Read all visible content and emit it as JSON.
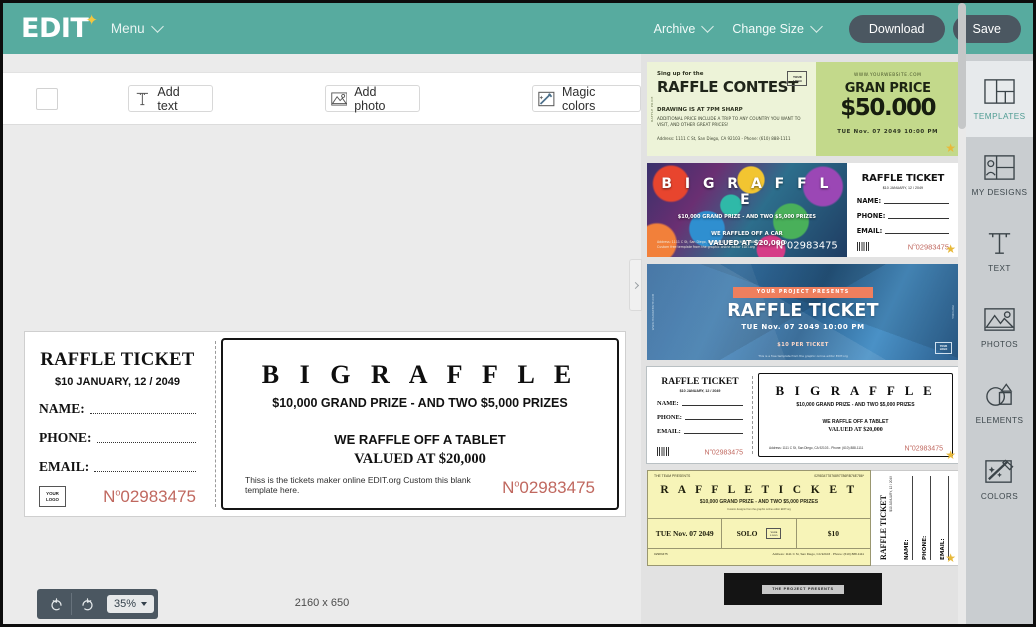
{
  "header": {
    "logo": "EDIT",
    "logo_star_icon": "star-icon",
    "menu_label": "Menu",
    "menu_chevron_icon": "chevron-down-icon",
    "archive_label": "Archive",
    "archive_chevron_icon": "chevron-down-icon",
    "change_size_label": "Change Size",
    "change_size_chevron_icon": "chevron-down-icon",
    "download_label": "Download",
    "save_label": "Save",
    "bg_color": "#57ab9f",
    "button_color": "#4b5761"
  },
  "toolbar": {
    "checkbox_name": "selection-checkbox",
    "add_text_label": "Add text",
    "add_text_icon": "text-tool-icon",
    "add_photo_label": "Add photo",
    "add_photo_icon": "image-icon",
    "magic_colors_label": "Magic colors",
    "magic_colors_icon": "magic-wand-icon"
  },
  "canvas": {
    "size_label": "2160 x 650",
    "zoom_level": "35%",
    "undo_icon": "undo-icon",
    "redo_icon": "redo-icon",
    "zoom_caret_icon": "caret-down-icon",
    "collapse_icon": "chevron-right-icon",
    "ticket": {
      "stub": {
        "title": "RAFFLE TICKET",
        "subtitle": "$10 JANUARY, 12 / 2049",
        "fields": [
          "NAME:",
          "PHONE:",
          "EMAIL:"
        ],
        "logo_line1": "YOUR",
        "logo_line2": "LOGO",
        "number_prefix": "N",
        "number_sup": "o",
        "number": "02983475",
        "number_color": "#c0685f"
      },
      "main": {
        "title": "B I G   R A F F L E",
        "subtitle": "$10,000 GRAND PRIZE - AND TWO $5,000 PRIZES",
        "line1": "WE RAFFLE OFF A TABLET",
        "line2": "VALUED AT $20,000",
        "note": "Thiss is the tickets maker online EDIT.org Custom this blank template here.",
        "number_prefix": "N",
        "number_sup": "o",
        "number": "02983475"
      }
    }
  },
  "templates": [
    {
      "id": "raffle-contest-green",
      "selected": false,
      "left": {
        "kicker": "Sing up for the",
        "title": "RAFFLE CONTEST",
        "subtitle": "DRAWING IS AT 7PM SHARP",
        "body": "ADDITIONAL PRICE INCLUDE A TRIP TO ANY COUNTRY YOU WANT TO VISIT, AND OTHER GREAT PRICES!",
        "address": "Address: 1111 C St, San Diego, CA 92103 - Phone: (610) 888-1111",
        "logo_line1": "YOUR",
        "logo_line2": "LOGO",
        "side_text": "RAFFLE PRICE"
      },
      "right": {
        "website": "WWW.YOURWEBSITE.COM",
        "title": "GRAN PRICE",
        "amount": "$50.000",
        "datetime": "TUE   Nov. 07   2049   10:00 PM",
        "side_text": "EDIT.ORG TEMPLATE"
      }
    },
    {
      "id": "big-raffle-colorful",
      "selected": false,
      "left": {
        "title": "B I G   R A F F L E",
        "subtitle": "$10,000 GRAND PRIZE - AND TWO $5,000 PRIZES",
        "line1": "WE RAFFLED OFF A CAR",
        "line2": "VALUED AT $20,000",
        "address_line1": "Address: 1111 C St, San Diego, CA 92103 - Phone: (610) 888-1111",
        "address_line2": "Custom free template from the graphic online editor EDIT.org",
        "number_prefix": "N",
        "number_sup": "o",
        "number": "02983475"
      },
      "right": {
        "title": "RAFFLE TICKET",
        "subtitle": "$10 JANUARY, 12 / 2049",
        "fields": [
          "NAME:",
          "PHONE:",
          "EMAIL:"
        ],
        "number_prefix": "N",
        "number_sup": "o",
        "number": "02983475"
      }
    },
    {
      "id": "raffle-ticket-blue-polygon",
      "selected": false,
      "banner": "YOUR PROJECT PRESENTS",
      "title": "RAFFLE TICKET",
      "datetime": "TUE   Nov. 07   2049   10:00 PM",
      "price": "$10 PER TICKET",
      "note": "This is a free template from the graphic online editor EDIT.org",
      "side_left": "WWW.YOURWEBSITE.COM",
      "side_right": "EDIT.ORG",
      "logo_line1": "YOUR",
      "logo_line2": "LOGO"
    },
    {
      "id": "big-raffle-bw",
      "selected": true,
      "left": {
        "title": "RAFFLE TICKET",
        "subtitle": "$10 JANUARY, 12 / 2049",
        "fields": [
          "NAME:",
          "PHONE:",
          "EMAIL:"
        ],
        "number_prefix": "N",
        "number_sup": "o",
        "number": "02983475"
      },
      "right": {
        "title": "B I G   R A F F L E",
        "subtitle": "$10,000 GRAND PRIZE - AND TWO $5,000 PRIZES",
        "line1": "WE RAFFLE OFF A TABLET",
        "line2": "VALUED AT $20,000",
        "address": "Address: 1111 C St, San Diego, CA 92103 - Phone: (610) 888-1111",
        "number_prefix": "N",
        "number_sup": "o",
        "number": "02983475"
      }
    },
    {
      "id": "raffle-ticket-yellow",
      "selected": false,
      "kicker": "THE TEAM PRESENTS",
      "barcode_text": "02983477876897786RB76E786*",
      "title": "R A F F L E   T I C K E T",
      "subtitle": "$10,000 GRAND PRIZE - AND TWO $5,000 PRIZES",
      "note": "Custom designs from the graphic online editor EDIT.org",
      "cells": [
        "TUE  Nov. 07 2049",
        "SOLO",
        "$10"
      ],
      "cell_logo_line1": "YOUR",
      "cell_logo_line2": "LOGO",
      "bottom_number": "02983475",
      "bottom_address": "Address: 1111 C St, San Diego, CA 92103 · Phone: (610) 888-1111",
      "stub_title": "RAFFLE TICKET",
      "stub_subtitle": "$10 JANUARY, 12 / 2049",
      "stub_fields": [
        "NAME:",
        "PHONE:",
        "EMAIL:"
      ]
    },
    {
      "id": "project-presents-black",
      "selected": false,
      "badge": "THE PROJECT PRESENTS"
    }
  ],
  "sidebar": {
    "items": [
      {
        "label": "TEMPLATES",
        "icon": "templates-icon",
        "active": true
      },
      {
        "label": "MY DESIGNS",
        "icon": "my-designs-icon",
        "active": false
      },
      {
        "label": "TEXT",
        "icon": "text-icon",
        "active": false
      },
      {
        "label": "PHOTOS",
        "icon": "photos-icon",
        "active": false
      },
      {
        "label": "ELEMENTS",
        "icon": "elements-icon",
        "active": false
      },
      {
        "label": "COLORS",
        "icon": "colors-icon",
        "active": false
      }
    ],
    "active_color": "#4f9c93"
  }
}
